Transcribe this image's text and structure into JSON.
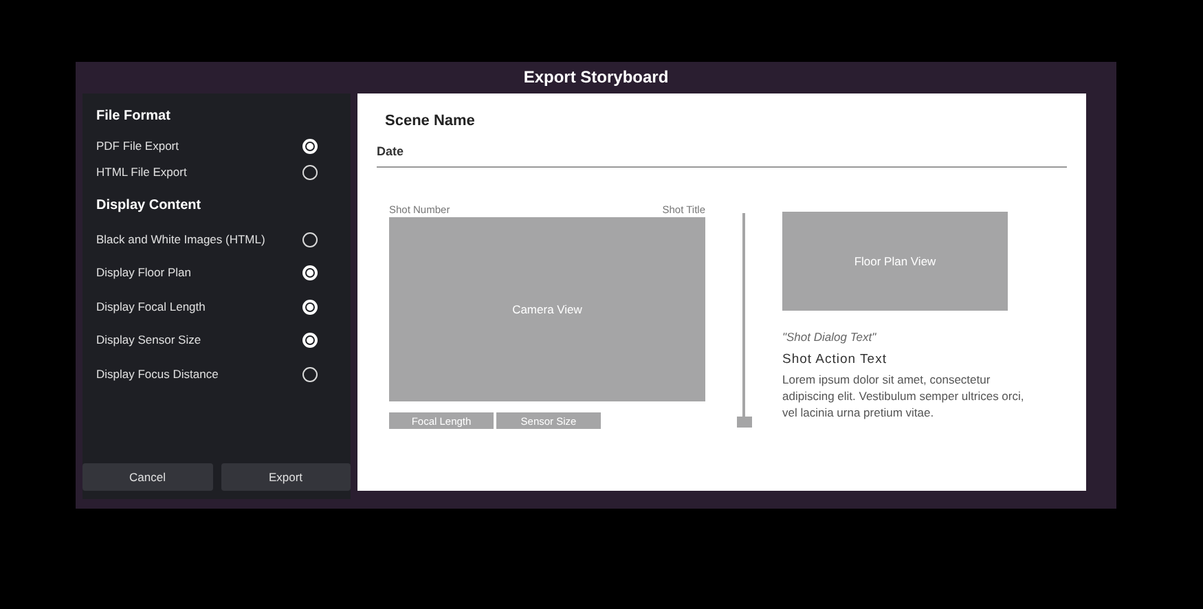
{
  "window": {
    "title": "Export Storyboard"
  },
  "file_format": {
    "heading": "File Format",
    "options": [
      {
        "label": "PDF File Export",
        "selected": true
      },
      {
        "label": "HTML File Export",
        "selected": false
      }
    ]
  },
  "display_content": {
    "heading": "Display Content",
    "options": [
      {
        "label": "Black and White Images (HTML)",
        "checked": false
      },
      {
        "label": "Display Floor Plan",
        "checked": true
      },
      {
        "label": "Display Focal Length",
        "checked": true
      },
      {
        "label": "Display Sensor Size",
        "checked": true
      },
      {
        "label": "Display Focus Distance",
        "checked": false
      }
    ]
  },
  "buttons": [
    "Cancel",
    "Export"
  ],
  "preview": {
    "scene_name": "Scene Name",
    "date": "Date",
    "shot_number": "Shot Number",
    "shot_title": "Shot Title",
    "camera_view": "Camera View",
    "tags": [
      "Focal Length",
      "Sensor Size"
    ],
    "floor_plan_view": "Floor Plan View",
    "dialog": "\"Shot Dialog Text\"",
    "action": "Shot Action Text",
    "body": "Lorem ipsum dolor sit amet, consectetur adipiscing elit. Vestibulum semper ultrices orci, vel lacinia urna pretium vitae."
  }
}
